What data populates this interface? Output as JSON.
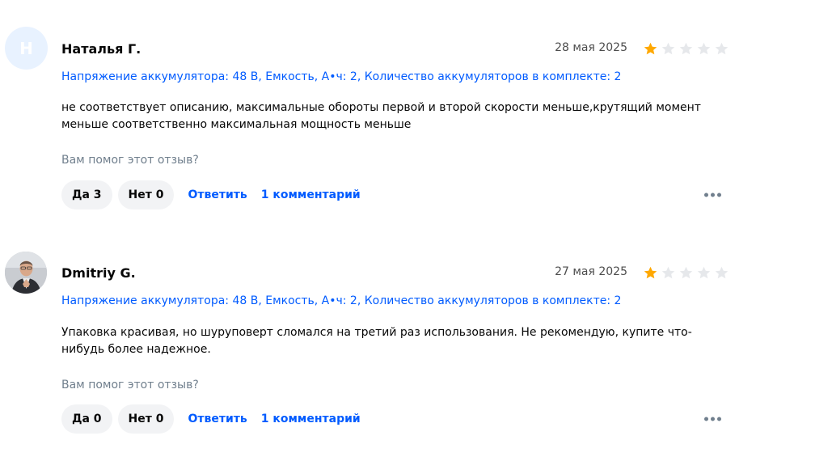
{
  "reviews": [
    {
      "avatar_letter": "Н",
      "author": "Наталья Г.",
      "date": "28 мая 2025",
      "rating": 1,
      "max_rating": 5,
      "variant": "Напряжение аккумулятора: 48 В, Емкость, А•ч: 2, Количество аккумуляторов в комплекте: 2",
      "text": "не соответствует описанию, максимальные обороты первой и второй скорости меньше,крутящий момент меньше соответственно максимальная мощность меньше",
      "helpful_question": "Вам помог этот отзыв?",
      "yes_label": "Да 3",
      "no_label": "Нет 0",
      "reply_label": "Ответить",
      "comments_label": "1 комментарий"
    },
    {
      "avatar_letter": "",
      "author": "Dmitriy G.",
      "date": "27 мая 2025",
      "rating": 1,
      "max_rating": 5,
      "variant": "Напряжение аккумулятора: 48 В, Емкость, А•ч: 2, Количество аккумуляторов в комплекте: 2",
      "text": "Упаковка красивая, но шуруповерт сломался на третий раз использования. Не рекомендую, купите что-нибудь более надежное.",
      "helpful_question": "Вам помог этот отзыв?",
      "yes_label": "Да 0",
      "no_label": "Нет 0",
      "reply_label": "Ответить",
      "comments_label": "1 комментарий"
    }
  ],
  "colors": {
    "accent": "#005bff",
    "star_filled": "#ffa800",
    "star_empty": "#e6e8eb",
    "pill_bg": "#f2f3f5",
    "muted": "#707f8d"
  },
  "icons": {
    "star": "star-icon",
    "more": "more-dots-icon"
  }
}
